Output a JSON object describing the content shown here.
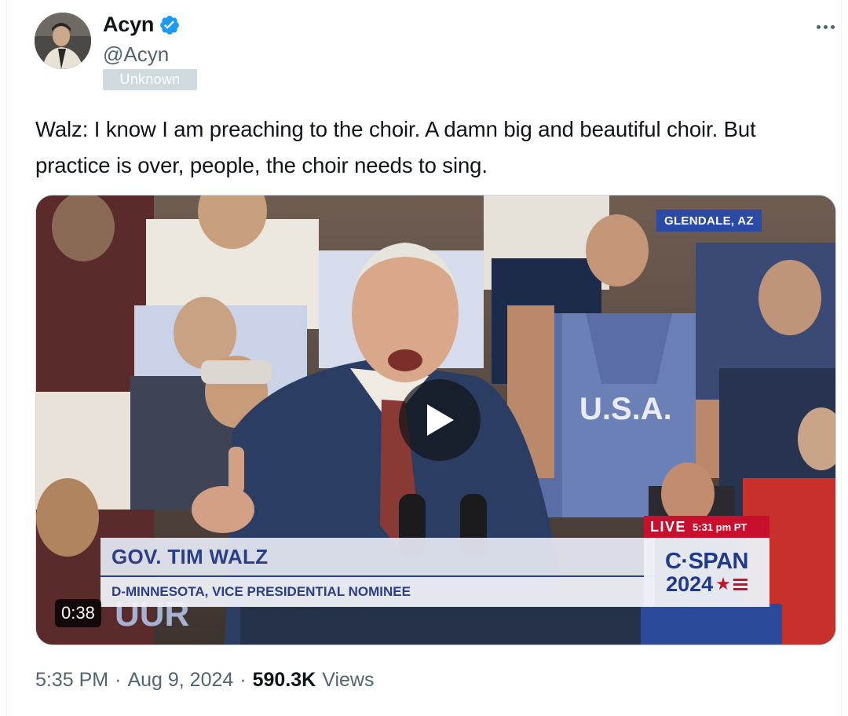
{
  "author": {
    "display_name": "Acyn",
    "handle": "@Acyn",
    "verified": true,
    "badge_label": "Unknown"
  },
  "tweet": {
    "text": "Walz: I know I am preaching to the choir. A damn big and beautiful choir. But practice is over, people, the choir needs to sing."
  },
  "video": {
    "duration": "0:38",
    "location": "GLENDALE, AZ",
    "lower_third_name": "GOV. TIM WALZ",
    "lower_third_subtitle": "D-MINNESOTA, VICE PRESIDENTIAL NOMINEE",
    "live_label": "LIVE",
    "live_time": "5:31 pm PT",
    "network_name": "C·SPAN",
    "network_year": "2024",
    "shirt_text": "U.S.A."
  },
  "meta": {
    "time": "5:35 PM",
    "date": "Aug 9, 2024",
    "views_count": "590.3K",
    "views_label": "Views",
    "separator": "·"
  },
  "icons": {
    "verified": "verified-badge-icon",
    "more": "more-horizontal-icon",
    "play": "play-icon"
  },
  "colors": {
    "verified_blue": "#1d9bf0",
    "secondary_text": "#536471",
    "badge_gray": "#cfd9de",
    "cspan_blue": "#2b3e86",
    "live_red": "#c8102e"
  }
}
